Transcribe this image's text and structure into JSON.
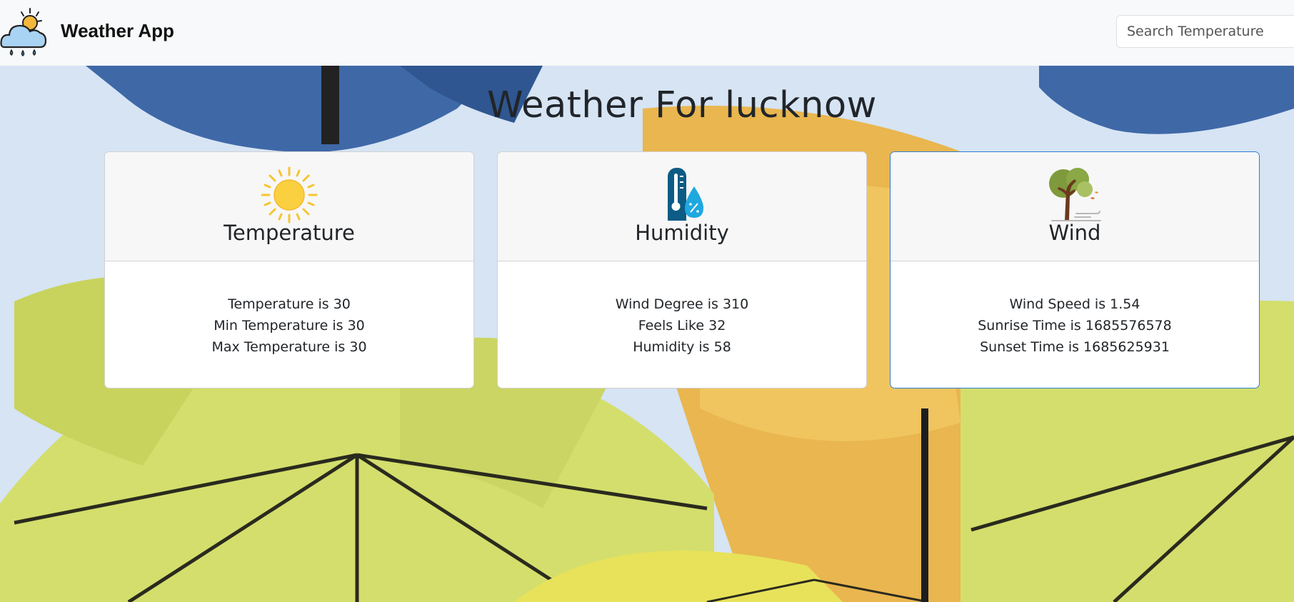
{
  "app": {
    "title": "Weather App"
  },
  "search": {
    "placeholder": "Search Temperature"
  },
  "heading": "Weather For lucknow",
  "cards": [
    {
      "title": "Temperature",
      "icon": "sun-icon",
      "lines": [
        "Temperature is 30",
        "Min Temperature is 30",
        "Max Temperature is 30"
      ]
    },
    {
      "title": "Humidity",
      "icon": "humidity-icon",
      "lines": [
        "Wind Degree is 310",
        "Feels Like 32",
        "Humidity is 58"
      ]
    },
    {
      "title": "Wind",
      "icon": "wind-tree-icon",
      "lines": [
        "Wind Speed is 1.54",
        "Sunrise Time is 1685576578",
        "Sunset Time is 1685625931"
      ]
    }
  ],
  "colors": {
    "navbar_bg": "#f8f9fa",
    "card_header_bg": "#f7f7f7",
    "active_card_border": "#2e7fd6",
    "umbrella_blue": "#3d67a6",
    "umbrella_yellow": "#d9e27a"
  }
}
